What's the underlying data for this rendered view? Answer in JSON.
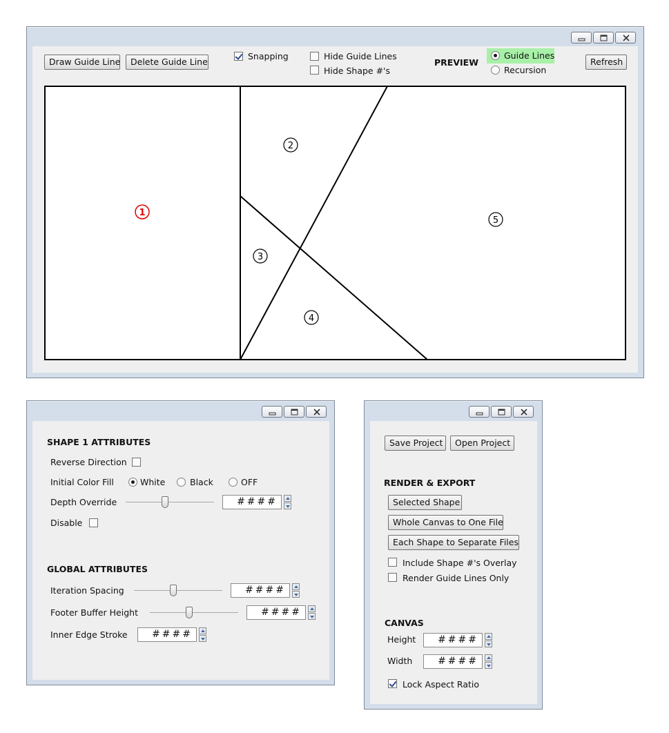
{
  "main_window": {
    "toolbar": {
      "draw_guide_line": "Draw Guide Line",
      "delete_guide_line": "Delete Guide Line",
      "snapping_label": "Snapping",
      "snapping_checked": true,
      "hide_guide_lines_label": "Hide Guide Lines",
      "hide_shape_numbers_label": "Hide Shape #'s",
      "preview_label": "PREVIEW",
      "preview_options": [
        "Guide Lines",
        "Recursion"
      ],
      "preview_selected": "Guide Lines",
      "refresh": "Refresh"
    },
    "canvas": {
      "shape_labels": [
        "1",
        "2",
        "3",
        "4",
        "5"
      ],
      "selected_shape": "1",
      "selected_color": "#e00000"
    }
  },
  "attributes_window": {
    "shape_heading": "SHAPE 1 ATTRIBUTES",
    "reverse_direction": "Reverse Direction",
    "initial_color_fill": "Initial Color Fill",
    "color_options": [
      "White",
      "Black",
      "OFF"
    ],
    "color_selected": "White",
    "depth_override": "Depth Override",
    "depth_value": "####",
    "disable": "Disable",
    "global_heading": "GLOBAL ATTRIBUTES",
    "iteration_spacing": "Iteration Spacing",
    "iteration_value": "####",
    "footer_buffer_height": "Footer Buffer Height",
    "footer_value": "####",
    "inner_edge_stroke": "Inner Edge Stroke",
    "stroke_value": "####"
  },
  "project_window": {
    "save_project": "Save Project",
    "open_project": "Open Project",
    "render_heading": "RENDER & EXPORT",
    "selected_shape": "Selected Shape",
    "whole_canvas": "Whole Canvas to One File",
    "each_shape": "Each Shape to Separate Files",
    "include_overlay": "Include Shape #'s Overlay",
    "render_guides_only": "Render Guide Lines Only",
    "canvas_heading": "CANVAS",
    "height_label": "Height",
    "height_value": "####",
    "width_label": "Width",
    "width_value": "####",
    "lock_aspect": "Lock Aspect Ratio",
    "lock_aspect_checked": true
  },
  "colors": {
    "window_frame": "#d4deea",
    "window_body": "#efefef",
    "preview_highlight": "#a8f0a8",
    "selected_shape": "#e00000"
  }
}
